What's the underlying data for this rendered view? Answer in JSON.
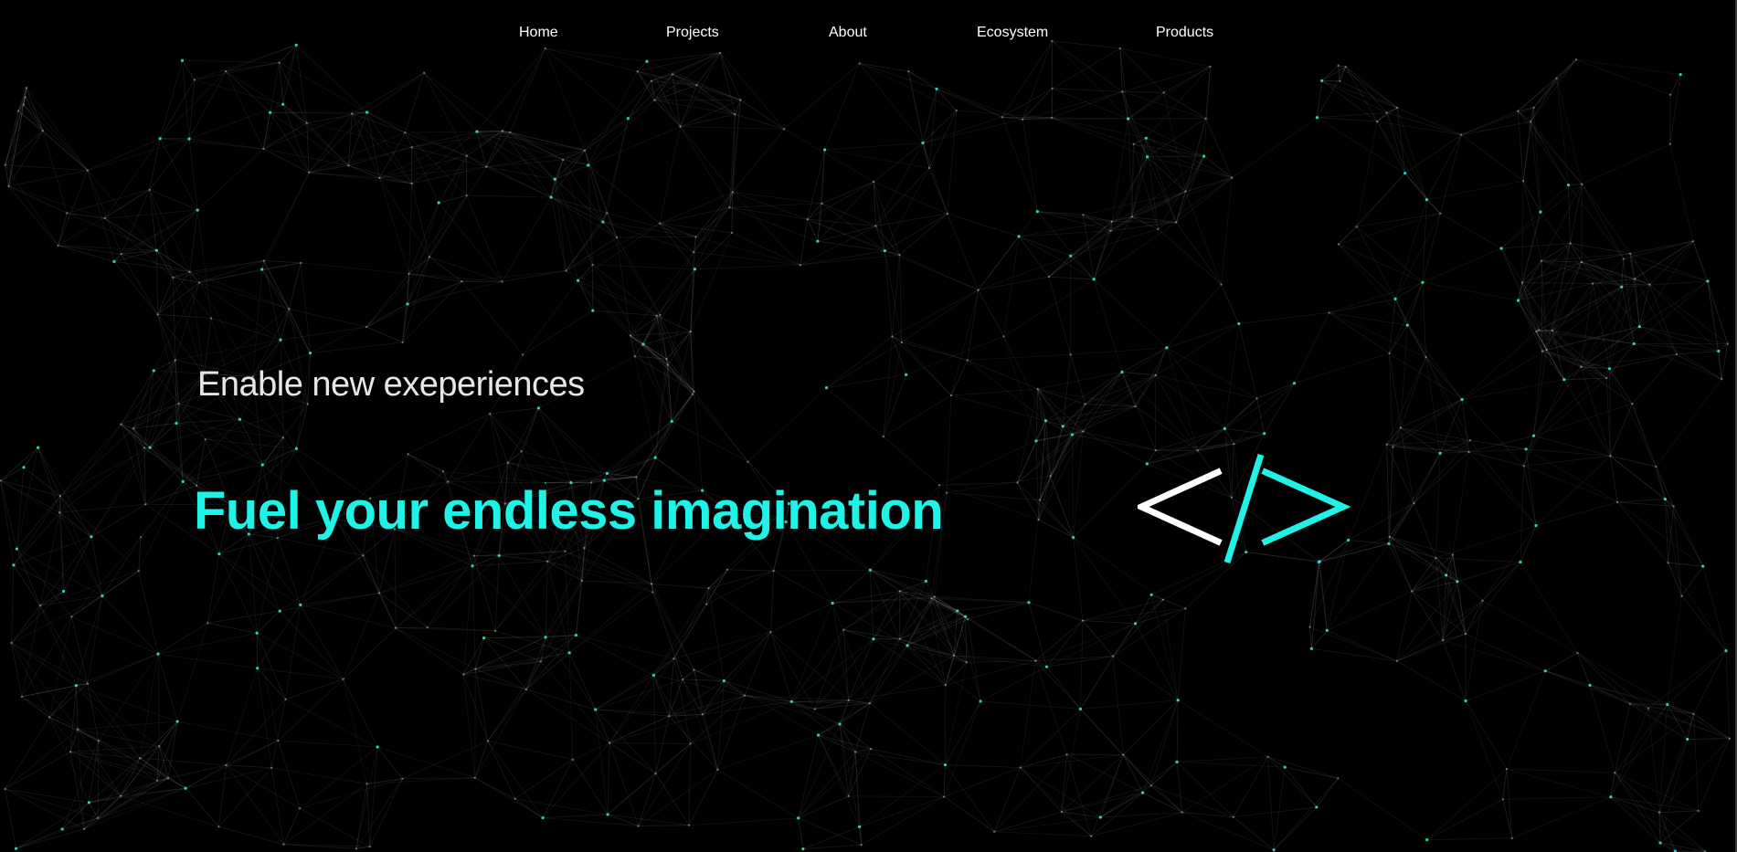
{
  "nav": {
    "items": [
      {
        "label": "Home"
      },
      {
        "label": "Projects"
      },
      {
        "label": "About"
      },
      {
        "label": "Ecosystem"
      },
      {
        "label": "Products"
      }
    ]
  },
  "hero": {
    "subtitle": "Enable new exeperiences",
    "title": "Fuel your endless imagination",
    "icon": "code-brackets-icon"
  },
  "colors": {
    "background": "#000000",
    "accent": "#1ff2e6",
    "nav_text": "#ffffff",
    "subtitle_text": "#e6e6e6",
    "network_node": "#2fe0d4",
    "network_line": "#ffffff"
  }
}
